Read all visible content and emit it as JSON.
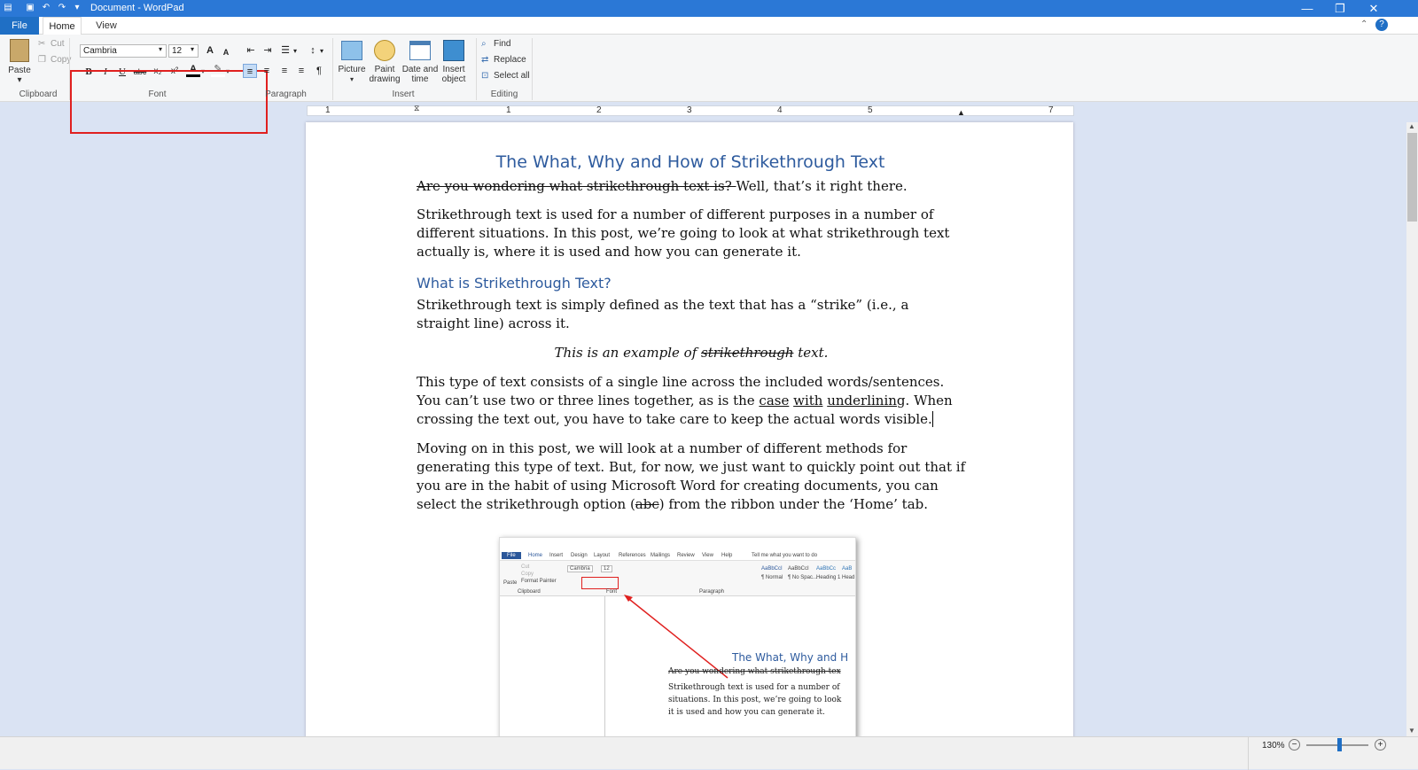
{
  "window": {
    "title": "Document - WordPad"
  },
  "tabs": [
    "File",
    "Home",
    "View"
  ],
  "clipboard": {
    "paste": "Paste",
    "cut": "Cut",
    "copy": "Copy",
    "label": "Clipboard"
  },
  "font": {
    "family": "Cambria",
    "size": "12",
    "label": "Font",
    "bold": "B",
    "italic": "I",
    "underline": "U",
    "strike": "abc",
    "sub": "x₂",
    "sup": "x²",
    "grow": "A",
    "shrink": "A"
  },
  "paragraph": {
    "label": "Paragraph"
  },
  "insert": {
    "picture": "Picture",
    "paint_line1": "Paint",
    "paint_line2": "drawing",
    "date_line1": "Date and",
    "date_line2": "time",
    "obj_line1": "Insert",
    "obj_line2": "object",
    "label": "Insert"
  },
  "editing": {
    "find": "Find",
    "replace": "Replace",
    "select_all": "Select all",
    "label": "Editing"
  },
  "ruler": [
    "1",
    "1",
    "2",
    "3",
    "4",
    "5",
    "7"
  ],
  "doc": {
    "title": "The What, Why and How of Strikethrough Text",
    "p1_strike": "Are you wondering what strikethrough text is? ",
    "p1_rest": "Well, that’s it right there.",
    "p2": "Strikethrough text is used for a number of different purposes in a number of different situations. In this post, we’re going to look at what strikethrough text actually is, where it is used and how you can generate it.",
    "h2": "What is Strikethrough Text?",
    "p3": "Strikethrough text is simply defined as the text that has a “strike” (i.e., a straight line) across it.",
    "ex_a": "This is an example of ",
    "ex_strike": "strikethrough",
    "ex_b": " text.",
    "p4_a": "This type of text consists of a single line across the included words/sentences. You can’t use two or three lines together, as is the ",
    "p4_u1": "case",
    "p4_u2": "with",
    "p4_u3": "underlining",
    "p4_b": ". When crossing the text out, you have to take care to keep the actual words visible.",
    "p5_a": "Moving on in this post, we will look at a number of different methods for generating this type of text. But, for now, we just want to quickly point out that if you are in the habit of using Microsoft Word for creating documents, you can select the strikethrough option (",
    "p5_strike": "abc",
    "p5_b": ") from the ribbon under the ‘Home’ tab."
  },
  "embedded": {
    "menu": [
      "File",
      "Home",
      "Insert",
      "Design",
      "Layout",
      "References",
      "Mailings",
      "Review",
      "View",
      "Help",
      "Tell me what you want to do"
    ],
    "styles": [
      "AaBbCcI",
      "AaBbCcI",
      "AaBbCc",
      "AaB"
    ],
    "style_names": [
      "¶ Normal",
      "¶ No Spac...",
      "Heading 1",
      "Head"
    ],
    "groups": [
      "Clipboard",
      "Font",
      "Paragraph"
    ],
    "clip": [
      "Cut",
      "Copy",
      "Format Painter",
      "Paste"
    ],
    "font": "Cambria",
    "size": "12",
    "title": "The What, Why and H",
    "strike": "Are you wondering what strikethrough tex",
    "body1": "Strikethrough text is used for a number of",
    "body2": "situations. In this post, we’re going to look",
    "body3": "it is used and how you can generate it."
  },
  "status": {
    "zoom": "130%"
  },
  "colors": {
    "titlebar": "#2b78d6",
    "highlight": "#e0201f",
    "heading": "#2e5b9e"
  }
}
